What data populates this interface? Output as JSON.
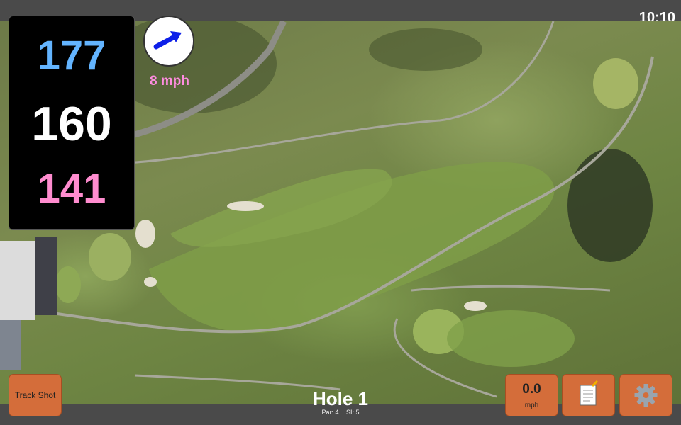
{
  "status": {
    "time": "10:10"
  },
  "distances": {
    "back": "177",
    "middle": "160",
    "front": "141"
  },
  "wind": {
    "speed": "8 mph",
    "icon": "wind-direction-arrow-icon"
  },
  "buttons": {
    "track_shot": "Track Shot",
    "speed_value": "0.0",
    "speed_unit": "mph",
    "notes_icon": "notepad-icon",
    "settings_icon": "gear-icon"
  },
  "hole": {
    "title": "Hole 1",
    "par": "Par: 4",
    "si": "SI: 5"
  },
  "colors": {
    "accent_button": "#d46d3a",
    "back": "#63b4ff",
    "front": "#ff8ccf",
    "wind_text": "#ff8ce0"
  }
}
